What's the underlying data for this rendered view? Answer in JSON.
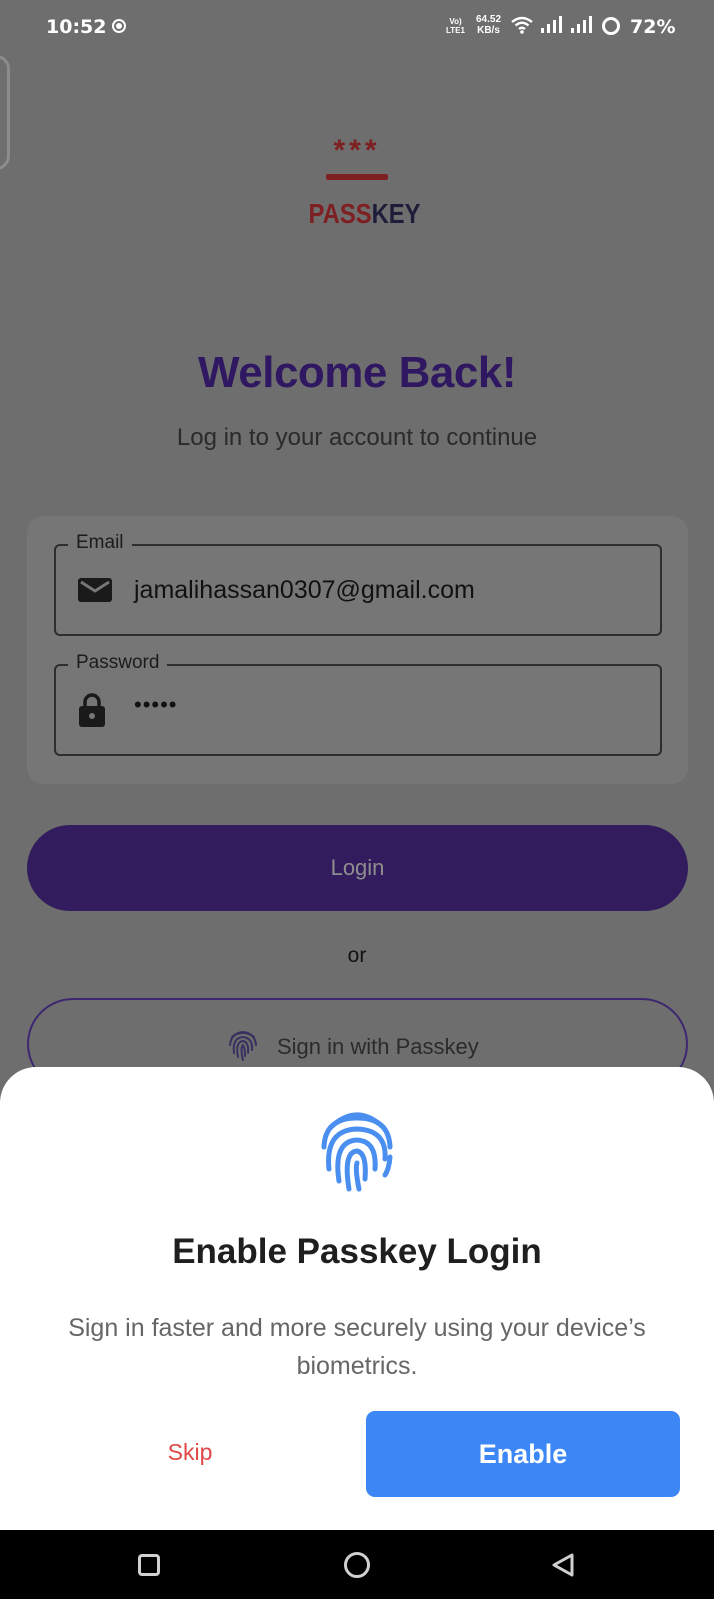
{
  "status_bar": {
    "time": "10:52",
    "volte_line1": "Vo)",
    "volte_line2": "LTE1",
    "speed_value": "64.52",
    "speed_unit": "KB/s",
    "battery": "72%"
  },
  "logo": {
    "stars": "***",
    "text_part1": "PASS",
    "text_part2": "KEY"
  },
  "welcome": {
    "title": "Welcome Back!",
    "subtitle": "Log in to your account to continue"
  },
  "form": {
    "email_label": "Email",
    "email_value": "jamalihassan0307@gmail.com",
    "password_label": "Password",
    "password_value": "•••••"
  },
  "buttons": {
    "login": "Login",
    "or": "or",
    "passkey_signin": "Sign in with Passkey"
  },
  "sheet": {
    "title": "Enable Passkey Login",
    "description": "Sign in faster and more securely using your device’s biometrics.",
    "skip": "Skip",
    "enable": "Enable"
  },
  "colors": {
    "primary": "#321c5e",
    "accent": "#3d86f6",
    "danger": "#e04848",
    "logo_red": "#7e1f22"
  },
  "icons": {
    "email": "mail-icon",
    "password": "lock-icon",
    "passkey": "fingerprint-icon"
  }
}
